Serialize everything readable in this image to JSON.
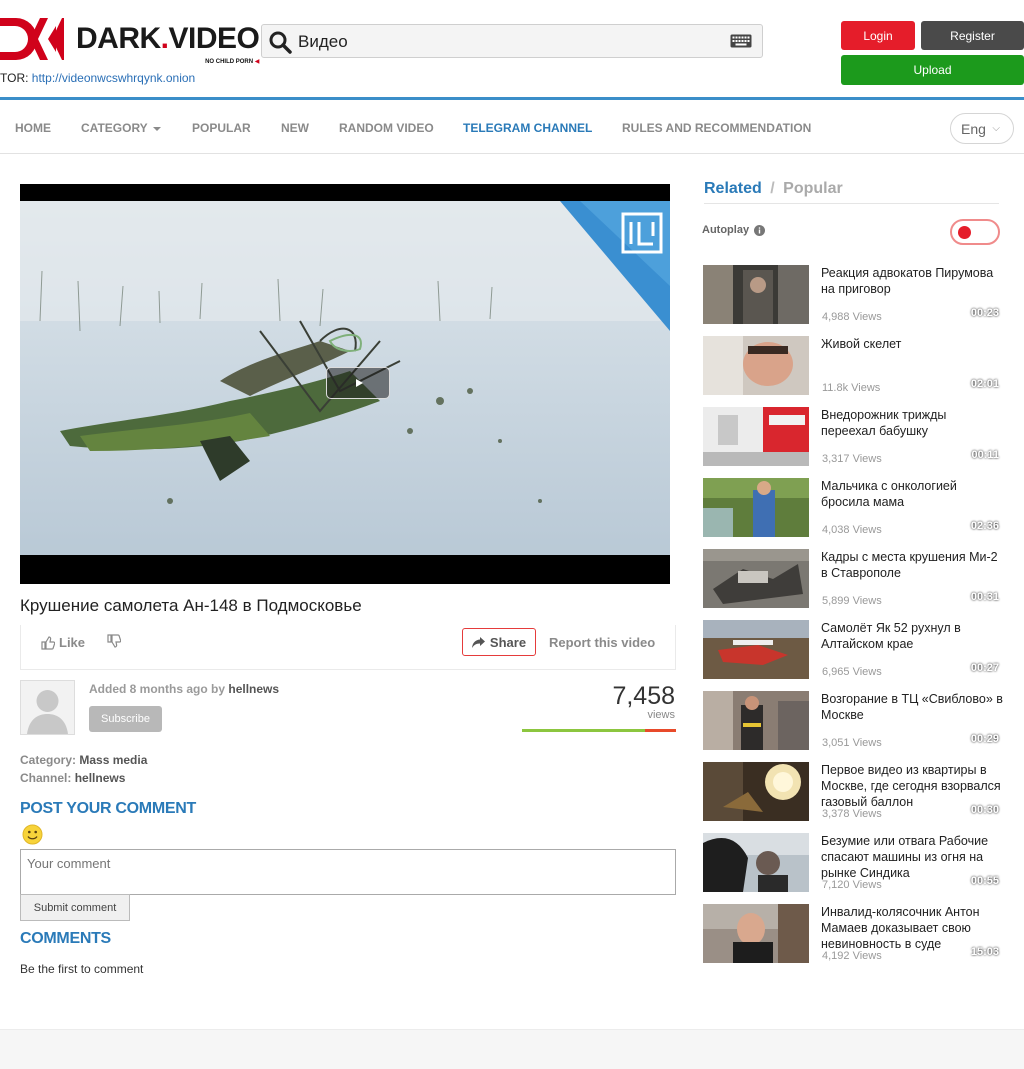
{
  "header": {
    "logo_name": "DARK",
    "logo_dot": ".",
    "logo_name2": "VIDEO",
    "logo_sub": "NO CHILD PORN",
    "tor_label": "TOR:",
    "tor_link": "http://videonwcswhrqynk.onion",
    "search_value": "Видео",
    "login": "Login",
    "register": "Register",
    "upload": "Upload"
  },
  "nav": {
    "items": [
      {
        "label": "HOME"
      },
      {
        "label": "CATEGORY"
      },
      {
        "label": "POPULAR"
      },
      {
        "label": "NEW"
      },
      {
        "label": "RANDOM VIDEO"
      },
      {
        "label": "TELEGRAM CHANNEL"
      },
      {
        "label": "RULES AND RECOMMENDATION"
      }
    ],
    "language": "Eng"
  },
  "video": {
    "title": "Крушение самолета Ан-148 в Подмосковье",
    "like": "Like",
    "share": "Share",
    "report": "Report this video",
    "added_prefix": "Added 8 months ago by",
    "uploader": "hellnews",
    "subscribe": "Subscribe",
    "views_count": "7,458",
    "views_label": "views",
    "rating_fraction": 0.8,
    "category_label": "Category",
    "category_value": "Mass media",
    "channel_label": "Channel",
    "channel_value": "hellnews"
  },
  "comments": {
    "post_title": "POST YOUR COMMENT",
    "placeholder": "Your comment",
    "submit": "Submit comment",
    "title": "COMMENTS",
    "empty": "Be the first to comment"
  },
  "sidebar": {
    "tab_related": "Related",
    "tab_sep": "/",
    "tab_popular": "Popular",
    "autoplay": "Autoplay",
    "items": [
      {
        "title": "Реакция адвокатов Пирумова на приговор",
        "duration": "00:23",
        "views": "4,988 Views"
      },
      {
        "title": "Живой скелет",
        "duration": "02:01",
        "views": "11.8k Views"
      },
      {
        "title": "Внедорожник трижды переехал бабушку",
        "duration": "00:11",
        "views": "3,317 Views"
      },
      {
        "title": "Мальчика с онкологией бросила мама",
        "duration": "02:36",
        "views": "4,038 Views"
      },
      {
        "title": "Кадры с места крушения Ми-2 в Ставрополе",
        "duration": "00:31",
        "views": "5,899 Views"
      },
      {
        "title": "Самолёт Як 52 рухнул в Алтайском крае",
        "duration": "00:27",
        "views": "6,965 Views"
      },
      {
        "title": "Возгорание в ТЦ «Свиблово» в Москве",
        "duration": "00:29",
        "views": "3,051 Views"
      },
      {
        "title": "Первое видео из квартиры в Москве, где сегодня взорвался газовый баллон",
        "duration": "00:30",
        "views": "3,378 Views"
      },
      {
        "title": "Безумие или отвага Рабочие спасают машины из огня на рынке Синдика",
        "duration": "00:55",
        "views": "7,120 Views"
      },
      {
        "title": "Инвалид-колясочник Антон Мамаев доказывает свою невиновность в суде",
        "duration": "15:03",
        "views": "4,192 Views"
      }
    ]
  }
}
